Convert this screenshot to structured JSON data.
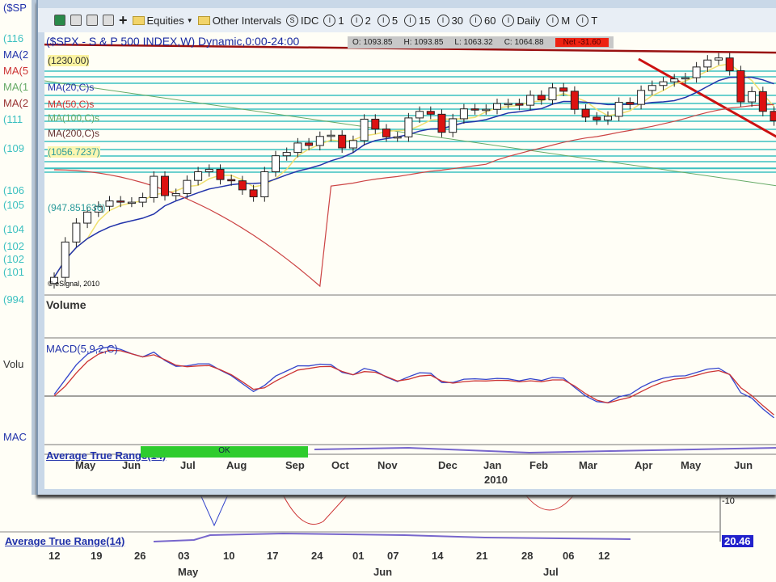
{
  "background_window": {
    "left_labels": [
      "($SP",
      "(116",
      "MA(2",
      "MA(5",
      "MA(1",
      "MA(2",
      "(111",
      "(109",
      "(106",
      "(105",
      "(104",
      "(102",
      "(102",
      "(101",
      "(994",
      "Volu",
      "MAC"
    ],
    "copyright": "© eSignal",
    "atr_label": "Average True Range(14)",
    "atr_value": "20.46",
    "macd_scale": "-10",
    "dates": [
      "12",
      "19",
      "26",
      "03",
      "10",
      "17",
      "24",
      "01",
      "07",
      "14",
      "21",
      "28",
      "06",
      "12"
    ],
    "months": [
      "May",
      "Jun",
      "Jul"
    ]
  },
  "toolbar": {
    "equities": "Equities",
    "other_intervals": "Other Intervals",
    "symbol_idc": "IDC",
    "intervals": [
      "1",
      "2",
      "5",
      "15",
      "30",
      "60",
      "Daily",
      "M",
      "T"
    ]
  },
  "chart": {
    "title": "($SPX - S & P 500 INDEX,W) Dynamic,0:00-24:00",
    "open": "O: 1093.85",
    "high": "H: 1093.85",
    "low": "L: 1063.32",
    "close": "C: 1064.88",
    "net": "Net -31.60",
    "labels": {
      "level_top": "(1230.00)",
      "ma20": "MA(20,C)s",
      "ma50": "MA(50,C)s",
      "ma100": "MA(100,C)s",
      "ma200": "MA(200,C)s",
      "level_low": "(947.851636)",
      "level_1056": "(1056.7237)"
    },
    "copyright": "© eSignal, 2010",
    "volume_label": "Volume",
    "macd_label": "MACD(5,9,2,C)",
    "atr_label": "Average True Range(14)",
    "ok_label": "OK",
    "months": [
      "May",
      "Jun",
      "Jul",
      "Aug",
      "Sep",
      "Oct",
      "Nov",
      "Dec",
      "Jan",
      "Feb",
      "Mar",
      "Apr",
      "May",
      "Jun"
    ],
    "year": "2010",
    "colors": {
      "up": "#ffffff",
      "down": "#dd1111",
      "ma20": "#2233aa",
      "ma50": "#cc4444",
      "ma10": "#f0e070",
      "level": "#3cc0c0",
      "trend": "#cc1111",
      "macd": "#3344cc",
      "signal": "#cc3333"
    }
  },
  "chart_data": {
    "type": "candlestick",
    "interval": "weekly",
    "closes": [
      683,
      769,
      815,
      842,
      856,
      869,
      866,
      866,
      877,
      929,
      882,
      887,
      919,
      940,
      946,
      921,
      918,
      896,
      879,
      940,
      979,
      987,
      1010,
      1004,
      1026,
      1029,
      998,
      1016,
      1068,
      1044,
      1025,
      1025,
      1071,
      1087,
      1080,
      1036,
      1069,
      1093,
      1091,
      1092,
      1106,
      1106,
      1102,
      1126,
      1115,
      1144,
      1136,
      1092,
      1073,
      1066,
      1075,
      1109,
      1104,
      1138,
      1150,
      1159,
      1166,
      1169,
      1195,
      1212,
      1217,
      1186,
      1110,
      1135,
      1087,
      1064
    ],
    "ylim": [
      640,
      1240
    ],
    "levels": [
      1230.0,
      947.851636
    ]
  }
}
